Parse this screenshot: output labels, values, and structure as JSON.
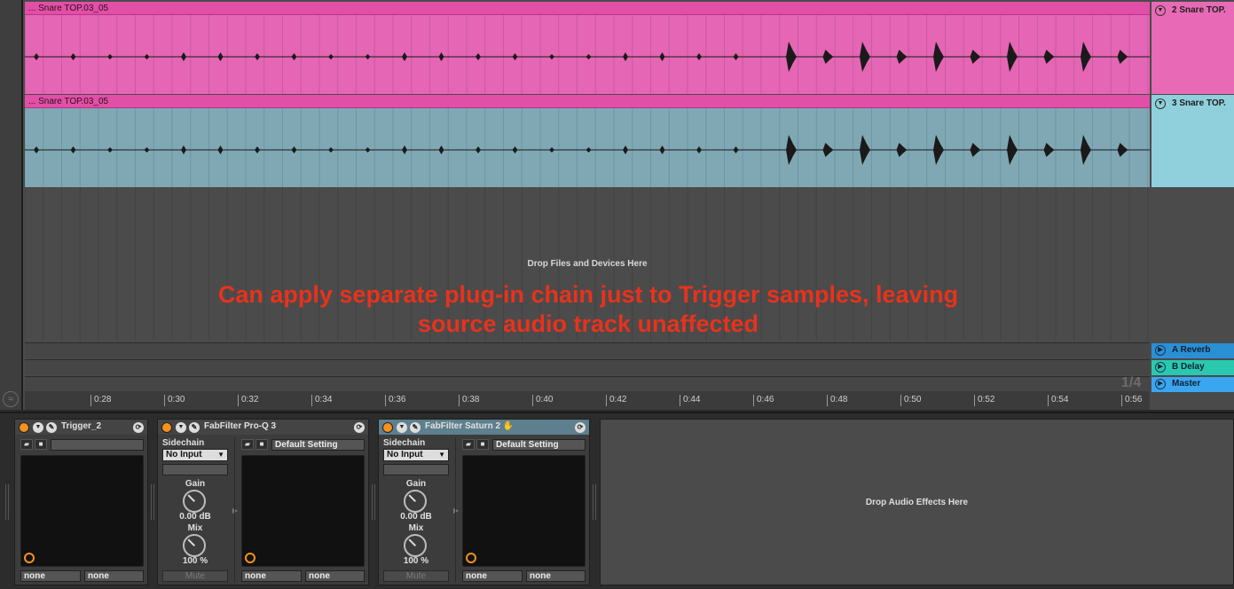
{
  "tracks": [
    {
      "clip_name": "... Snare TOP.03_05",
      "header_name": "2 Snare TOP.",
      "color": "#e466b4"
    },
    {
      "clip_name": "... Snare TOP.03_05",
      "header_name": "3 Snare TOP.",
      "color": "#7fa8b4"
    }
  ],
  "drop_files_label": "Drop Files and Devices Here",
  "annotation": {
    "line1": "Can apply separate plug-in chain just to Trigger samples, leaving",
    "line2": "source audio track unaffected",
    "color": "#e8321c"
  },
  "returns": [
    {
      "name": "A Reverb",
      "color": "#2b8fd6"
    },
    {
      "name": "B Delay",
      "color": "#2bc8b0"
    },
    {
      "name": "Master",
      "color": "#3aa6f0"
    }
  ],
  "quantization": "1/4",
  "ruler_labels": [
    "0:28",
    "0:30",
    "0:32",
    "0:34",
    "0:36",
    "0:38",
    "0:40",
    "0:42",
    "0:44",
    "0:46",
    "0:48",
    "0:50",
    "0:52",
    "0:54",
    "0:56"
  ],
  "devices": {
    "trigger": {
      "name": "Trigger_2",
      "macro_left": "none",
      "macro_right": "none"
    },
    "proq": {
      "name": "FabFilter Pro-Q 3",
      "sidechain_label": "Sidechain",
      "sidechain_value": "No Input",
      "gain_label": "Gain",
      "gain_value": "0.00 dB",
      "mix_label": "Mix",
      "mix_value": "100 %",
      "mute_label": "Mute",
      "preset": "Default Setting",
      "macro_left": "none",
      "macro_right": "none"
    },
    "saturn": {
      "name": "FabFilter Saturn 2",
      "sidechain_label": "Sidechain",
      "sidechain_value": "No Input",
      "gain_label": "Gain",
      "gain_value": "0.00 dB",
      "mix_label": "Mix",
      "mix_value": "100 %",
      "mute_label": "Mute",
      "preset": "Default Setting",
      "macro_left": "none",
      "macro_right": "none"
    }
  },
  "drop_effects_label": "Drop Audio Effects Here"
}
